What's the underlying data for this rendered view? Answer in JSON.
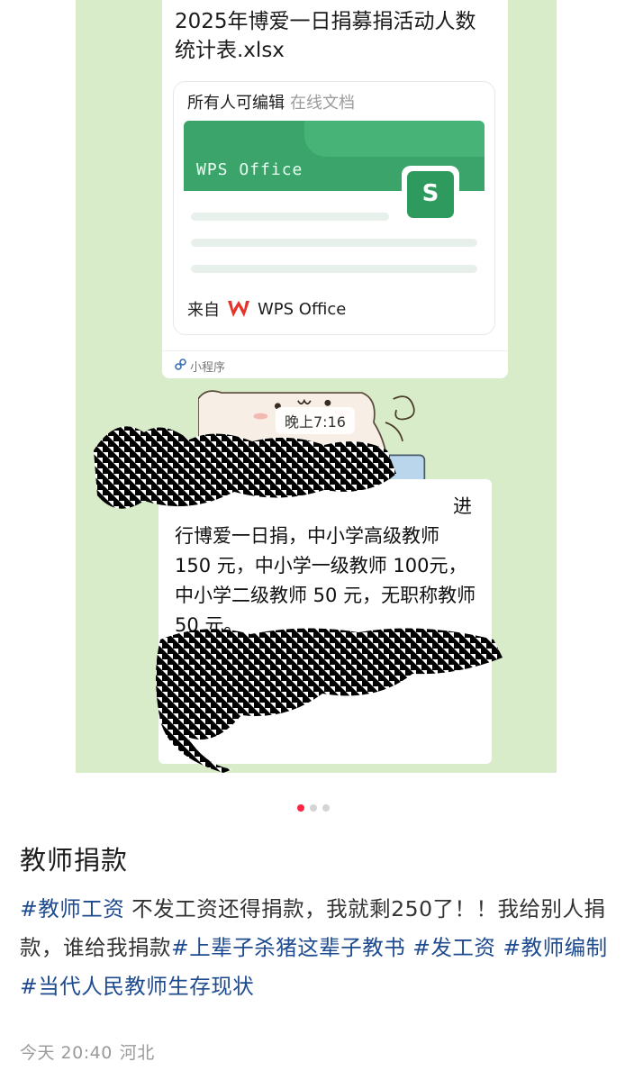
{
  "screenshot": {
    "file_message": {
      "title": "2025年博爱一日捐募捐活动人数统计表.xlsx",
      "permission": "所有人可编辑",
      "doc_type": "在线文档",
      "banner_brand": "WPS Office",
      "app_icon_letter": "S",
      "from_label": "来自",
      "from_app": "WPS Office",
      "mini_program": "小程序"
    },
    "timestamp": "晚上7:16",
    "text_message": {
      "first_line_tail": "进",
      "body": "行博爱一日捐，中小学高级教师 150 元，中小学一级教师 100元，中小学二级教师 50 元，无职称教师 50 元。"
    },
    "colors": {
      "chat_bg": "#d8ecc9",
      "wps_green": "#3aa46b"
    }
  },
  "carousel": {
    "total": 3,
    "active_index": 0
  },
  "post": {
    "title": "教师捐款",
    "tag1": "#教师工资",
    "text1": " 不发工资还得捐款，我就剩250了！！我给别人捐款，谁给我捐款",
    "tag2": "#上辈子杀猪这辈子教书",
    "tag3": "#发工资",
    "tag4": "#教师编制",
    "tag5": "#当代人民教师生存现状",
    "date": "今天 20:40",
    "location": "河北",
    "link_color": "#1e4a8f"
  }
}
